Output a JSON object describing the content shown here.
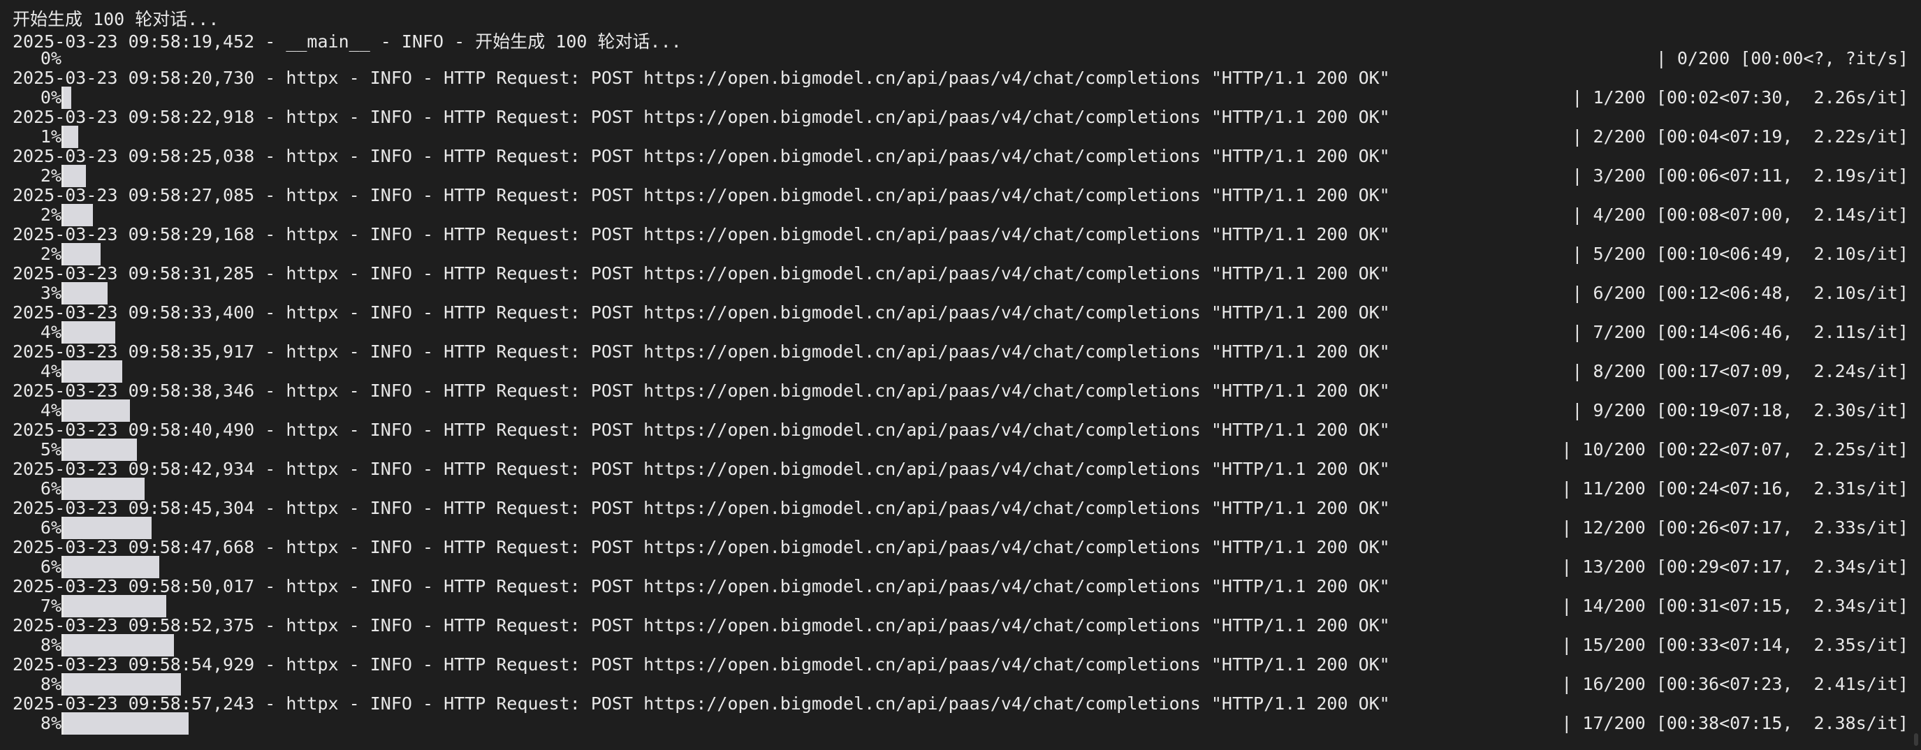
{
  "lines": [
    "开始生成 100 轮对话...",
    "2025-03-23 09:58:19,452 - __main__ - INFO - 开始生成 100 轮对话...",
    "2025-03-23 09:58:20,730 - httpx - INFO - HTTP Request: POST https://open.bigmodel.cn/api/paas/v4/chat/completions \"HTTP/1.1 200 OK\"",
    "2025-03-23 09:58:22,918 - httpx - INFO - HTTP Request: POST https://open.bigmodel.cn/api/paas/v4/chat/completions \"HTTP/1.1 200 OK\"",
    "2025-03-23 09:58:25,038 - httpx - INFO - HTTP Request: POST https://open.bigmodel.cn/api/paas/v4/chat/completions \"HTTP/1.1 200 OK\"",
    "2025-03-23 09:58:27,085 - httpx - INFO - HTTP Request: POST https://open.bigmodel.cn/api/paas/v4/chat/completions \"HTTP/1.1 200 OK\"",
    "2025-03-23 09:58:29,168 - httpx - INFO - HTTP Request: POST https://open.bigmodel.cn/api/paas/v4/chat/completions \"HTTP/1.1 200 OK\"",
    "2025-03-23 09:58:31,285 - httpx - INFO - HTTP Request: POST https://open.bigmodel.cn/api/paas/v4/chat/completions \"HTTP/1.1 200 OK\"",
    "2025-03-23 09:58:33,400 - httpx - INFO - HTTP Request: POST https://open.bigmodel.cn/api/paas/v4/chat/completions \"HTTP/1.1 200 OK\"",
    "2025-03-23 09:58:35,917 - httpx - INFO - HTTP Request: POST https://open.bigmodel.cn/api/paas/v4/chat/completions \"HTTP/1.1 200 OK\"",
    "2025-03-23 09:58:38,346 - httpx - INFO - HTTP Request: POST https://open.bigmodel.cn/api/paas/v4/chat/completions \"HTTP/1.1 200 OK\"",
    "2025-03-23 09:58:40,490 - httpx - INFO - HTTP Request: POST https://open.bigmodel.cn/api/paas/v4/chat/completions \"HTTP/1.1 200 OK\"",
    "2025-03-23 09:58:42,934 - httpx - INFO - HTTP Request: POST https://open.bigmodel.cn/api/paas/v4/chat/completions \"HTTP/1.1 200 OK\"",
    "2025-03-23 09:58:45,304 - httpx - INFO - HTTP Request: POST https://open.bigmodel.cn/api/paas/v4/chat/completions \"HTTP/1.1 200 OK\"",
    "2025-03-23 09:58:47,668 - httpx - INFO - HTTP Request: POST https://open.bigmodel.cn/api/paas/v4/chat/completions \"HTTP/1.1 200 OK\"",
    "2025-03-23 09:58:50,017 - httpx - INFO - HTTP Request: POST https://open.bigmodel.cn/api/paas/v4/chat/completions \"HTTP/1.1 200 OK\"",
    "2025-03-23 09:58:52,375 - httpx - INFO - HTTP Request: POST https://open.bigmodel.cn/api/paas/v4/chat/completions \"HTTP/1.1 200 OK\"",
    "2025-03-23 09:58:54,929 - httpx - INFO - HTTP Request: POST https://open.bigmodel.cn/api/paas/v4/chat/completions \"HTTP/1.1 200 OK\"",
    "2025-03-23 09:58:57,243 - httpx - INFO - HTTP Request: POST https://open.bigmodel.cn/api/paas/v4/chat/completions \"HTTP/1.1 200 OK\""
  ],
  "progress": [
    {
      "percent": "0%",
      "stats": "| 0/200 [00:00<?, ?it/s]",
      "completed": 0,
      "total": 200
    },
    {
      "percent": "0%",
      "stats": "| 1/200 [00:02<07:30,  2.26s/it]",
      "completed": 1,
      "total": 200
    },
    {
      "percent": "1%",
      "stats": "| 2/200 [00:04<07:19,  2.22s/it]",
      "completed": 2,
      "total": 200
    },
    {
      "percent": "2%",
      "stats": "| 3/200 [00:06<07:11,  2.19s/it]",
      "completed": 3,
      "total": 200
    },
    {
      "percent": "2%",
      "stats": "| 4/200 [00:08<07:00,  2.14s/it]",
      "completed": 4,
      "total": 200
    },
    {
      "percent": "2%",
      "stats": "| 5/200 [00:10<06:49,  2.10s/it]",
      "completed": 5,
      "total": 200
    },
    {
      "percent": "3%",
      "stats": "| 6/200 [00:12<06:48,  2.10s/it]",
      "completed": 6,
      "total": 200
    },
    {
      "percent": "4%",
      "stats": "| 7/200 [00:14<06:46,  2.11s/it]",
      "completed": 7,
      "total": 200
    },
    {
      "percent": "4%",
      "stats": "| 8/200 [00:17<07:09,  2.24s/it]",
      "completed": 8,
      "total": 200
    },
    {
      "percent": "4%",
      "stats": "| 9/200 [00:19<07:18,  2.30s/it]",
      "completed": 9,
      "total": 200
    },
    {
      "percent": "5%",
      "stats": "| 10/200 [00:22<07:07,  2.25s/it]",
      "completed": 10,
      "total": 200
    },
    {
      "percent": "6%",
      "stats": "| 11/200 [00:24<07:16,  2.31s/it]",
      "completed": 11,
      "total": 200
    },
    {
      "percent": "6%",
      "stats": "| 12/200 [00:26<07:17,  2.33s/it]",
      "completed": 12,
      "total": 200
    },
    {
      "percent": "6%",
      "stats": "| 13/200 [00:29<07:17,  2.34s/it]",
      "completed": 13,
      "total": 200
    },
    {
      "percent": "7%",
      "stats": "| 14/200 [00:31<07:15,  2.34s/it]",
      "completed": 14,
      "total": 200
    },
    {
      "percent": "8%",
      "stats": "| 15/200 [00:33<07:14,  2.35s/it]",
      "completed": 15,
      "total": 200
    },
    {
      "percent": "8%",
      "stats": "| 16/200 [00:36<07:23,  2.41s/it]",
      "completed": 16,
      "total": 200
    },
    {
      "percent": "8%",
      "stats": "| 17/200 [00:38<07:15,  2.38s/it]",
      "completed": 17,
      "total": 200
    }
  ],
  "colors": {
    "background": "#1e1e1e",
    "text": "#e8e8e8",
    "bar": "#d9d9de"
  }
}
